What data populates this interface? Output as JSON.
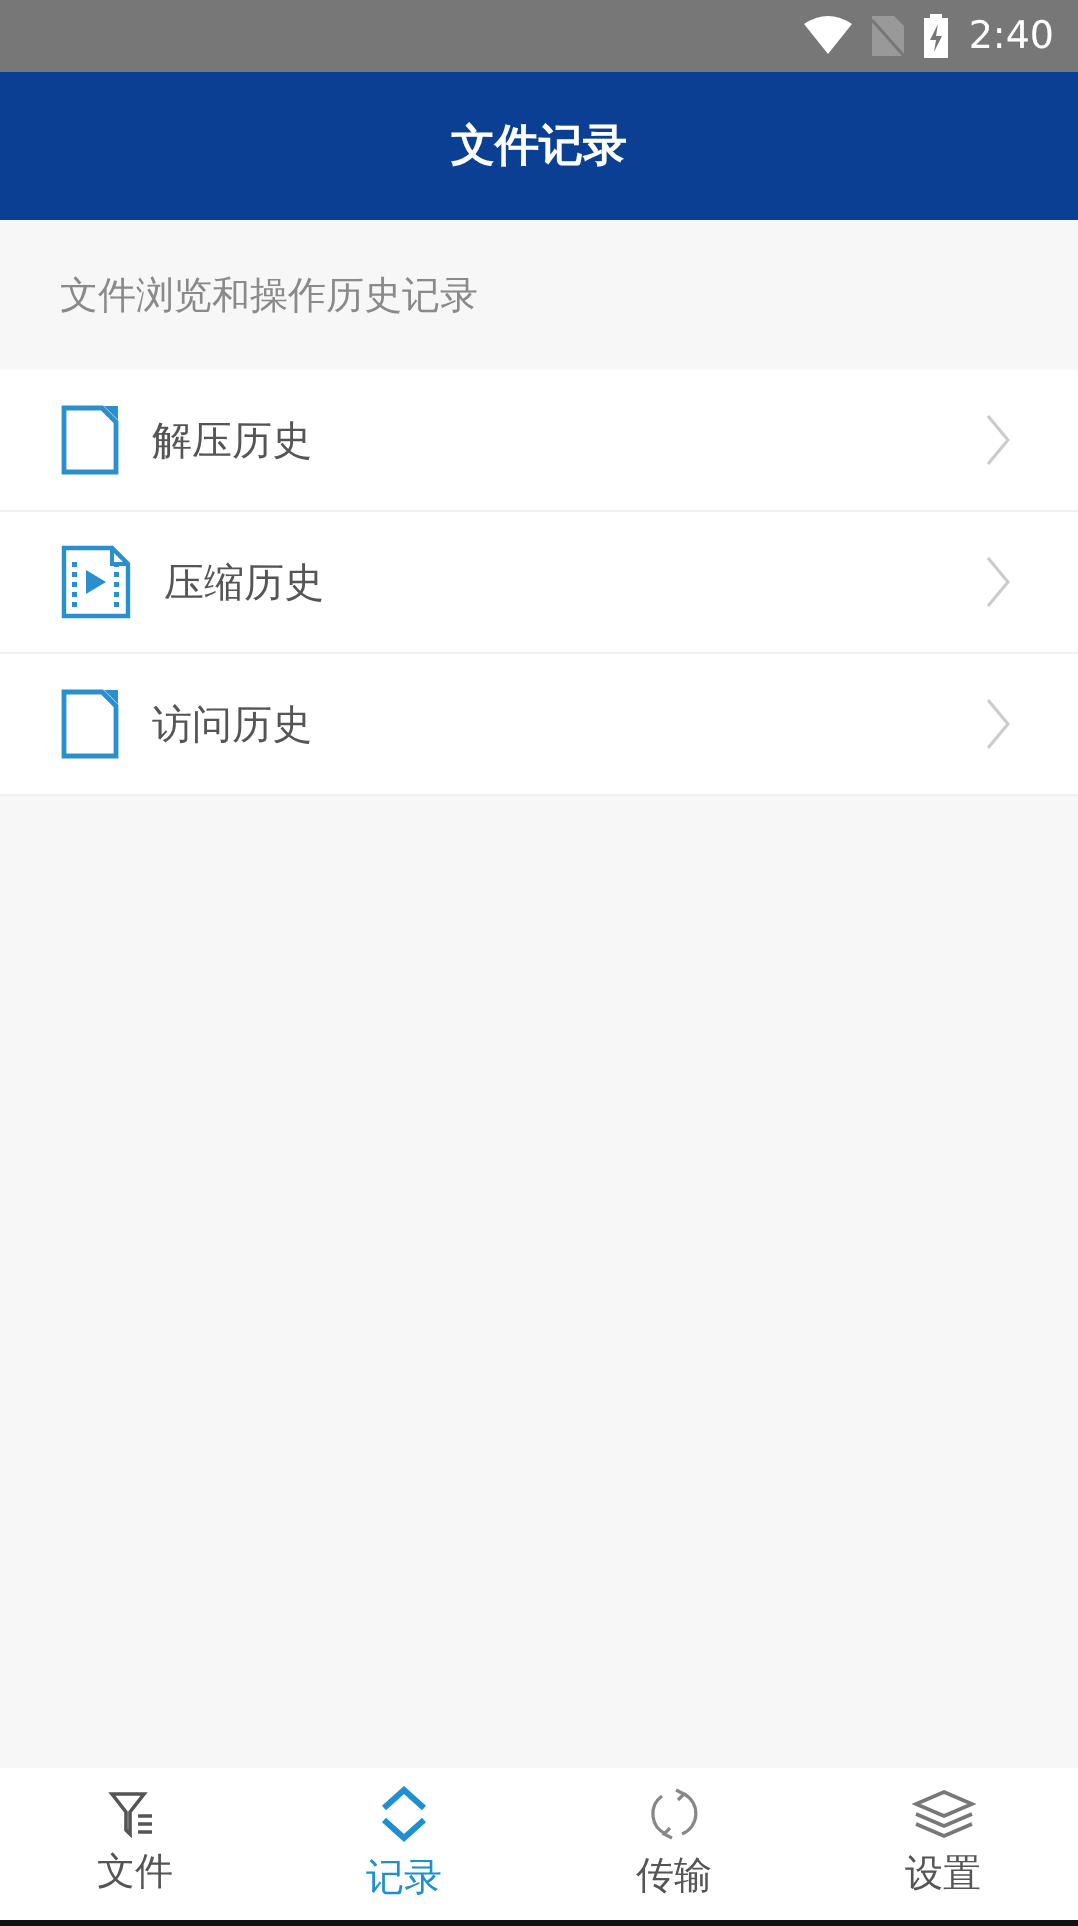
{
  "status_bar": {
    "time": "2:40"
  },
  "header": {
    "title": "文件记录"
  },
  "section": {
    "caption": "文件浏览和操作历史记录"
  },
  "items": [
    {
      "label": "解压历史",
      "kind": "document"
    },
    {
      "label": "压缩历史",
      "kind": "video"
    },
    {
      "label": "访问历史",
      "kind": "document"
    }
  ],
  "tabs": [
    {
      "label": "文件",
      "kind": "filter",
      "selected": false
    },
    {
      "label": "记录",
      "kind": "updown",
      "selected": true
    },
    {
      "label": "传输",
      "kind": "sync",
      "selected": false
    },
    {
      "label": "设置",
      "kind": "layers",
      "selected": false
    }
  ]
}
